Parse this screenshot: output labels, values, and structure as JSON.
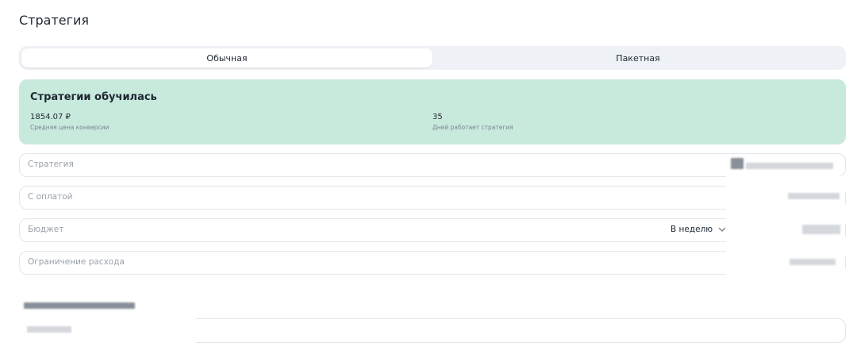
{
  "page": {
    "title": "Стратегия"
  },
  "tabs": [
    {
      "label": "Обычная",
      "active": true
    },
    {
      "label": "Пакетная",
      "active": false
    }
  ],
  "status": {
    "title": "Стратегии обучилась",
    "metrics": [
      {
        "value": "1854.07 ₽",
        "label": "Средняя цена конверсии"
      },
      {
        "value": "35",
        "label": "Дней работает стратегия"
      }
    ],
    "bg_color": "#c8eadd"
  },
  "fields": {
    "strategy": {
      "placeholder": "Стратегия"
    },
    "payment": {
      "placeholder": "С оплатой"
    },
    "budget": {
      "placeholder": "Бюджет",
      "period": "В неделю"
    },
    "spend_limit": {
      "placeholder": "Ограничение расхода"
    }
  },
  "icons": {
    "budget_dropdown": "chevron-down-icon"
  }
}
